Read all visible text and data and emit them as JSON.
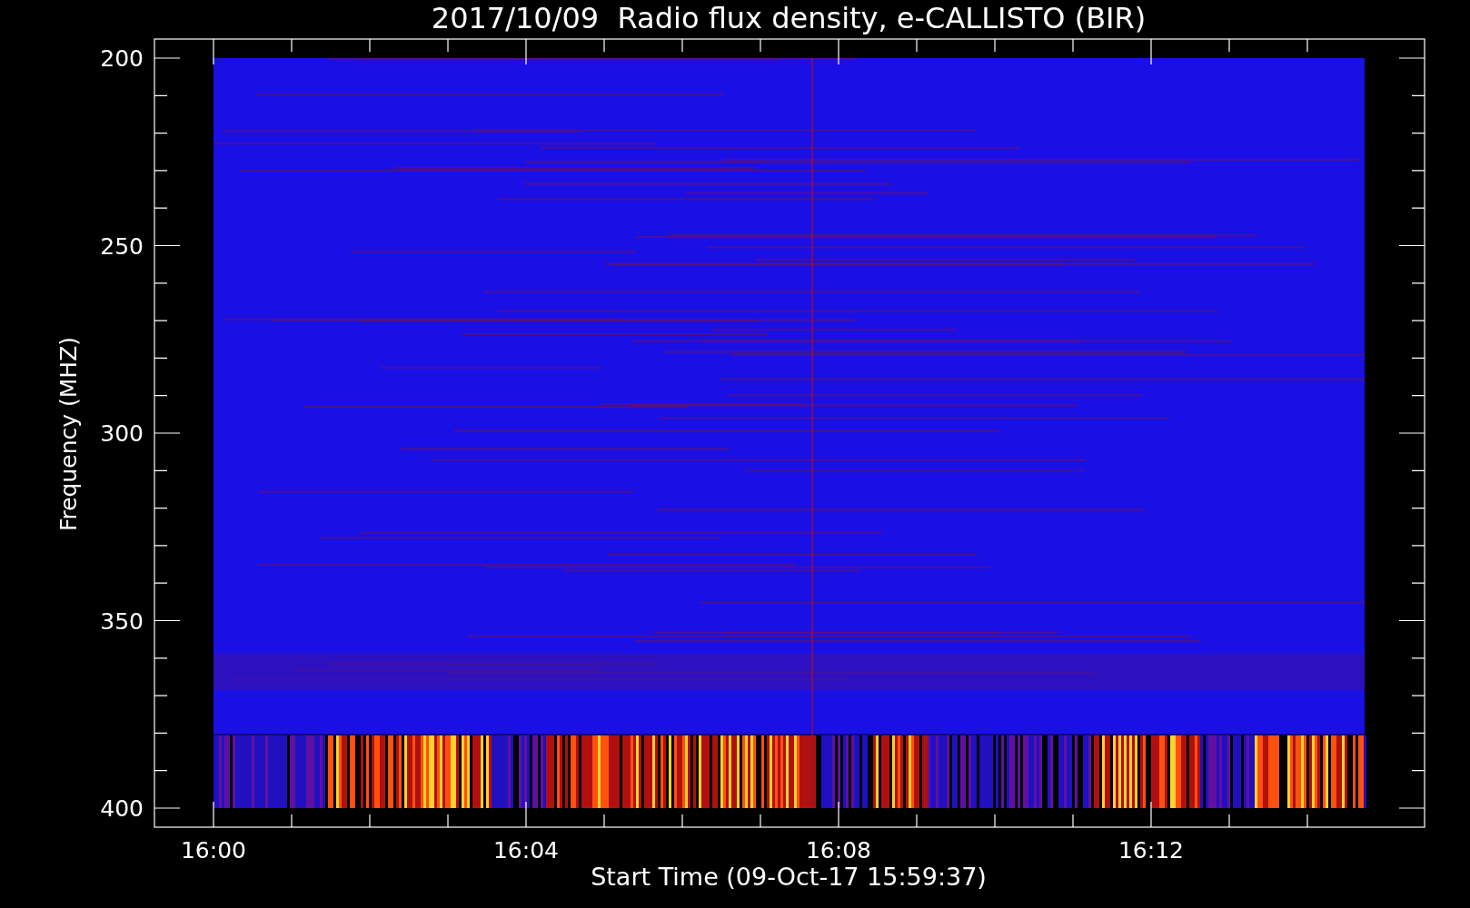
{
  "title": "2017/10/09  Radio flux density, e-CALLISTO (BIR)",
  "y_axis": {
    "label": "Frequency (MHZ)",
    "ticks": [
      "200",
      "250",
      "300",
      "350",
      "400"
    ]
  },
  "x_axis": {
    "label": "Start Time (09-Oct-17 15:59:37)",
    "ticks": [
      "16:00",
      "16:04",
      "16:08",
      "16:12"
    ]
  }
}
